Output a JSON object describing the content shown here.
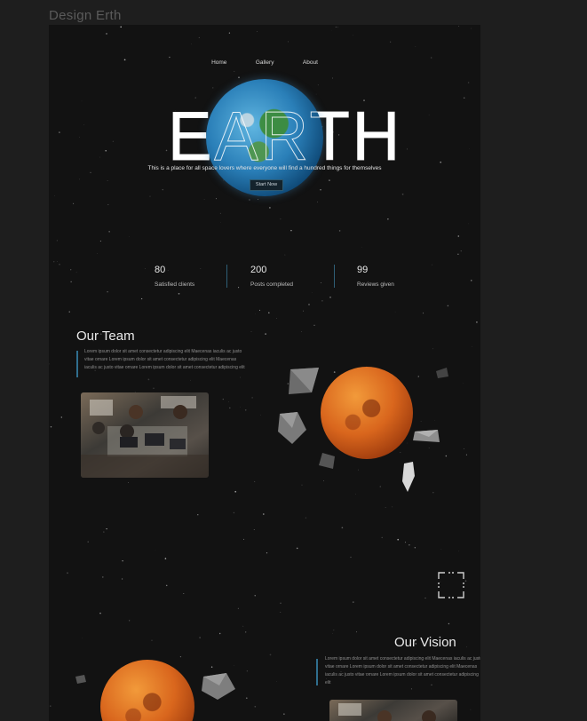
{
  "app": {
    "title": "Design Erth"
  },
  "nav": {
    "items": [
      "Home",
      "Gallery",
      "About"
    ]
  },
  "hero": {
    "title": "EARTH",
    "tagline": "This is a place for all space lovers where everyone will find a hundred things for themselves",
    "cta_label": "Start Now"
  },
  "stats": [
    {
      "value": "80",
      "label": "Satisfied clients"
    },
    {
      "value": "200",
      "label": "Posts completed"
    },
    {
      "value": "99",
      "label": "Reviews given"
    }
  ],
  "team": {
    "title": "Our Team",
    "text": "Lorem ipsum dolor sit amet consectetur adipiscing elit Maecenas iaculis ac justo vitae ornare Lorem ipsum dolor sit amet consectetur adipiscing elit Maecenas iaculis ac justo vitae ornare Lorem ipsum dolor sit amet consectetur adipiscing elit"
  },
  "vision": {
    "title": "Our Vision",
    "text": "Lorem ipsum dolor sit amet consectetur adipiscing elit Maecenas iaculis ac justo vitae ornare Lorem ipsum dolor sit amet consectetur adipiscing elit Maecenas iaculis ac justo vitae ornare Lorem ipsum dolor sit amet consectetur adipiscing elit"
  },
  "colors": {
    "background": "#121212",
    "canvas": "#1e1e1e",
    "accent": "#2f6e8e",
    "mars": "#d9661d"
  },
  "icons": {
    "frame": "frame-corners-icon"
  }
}
